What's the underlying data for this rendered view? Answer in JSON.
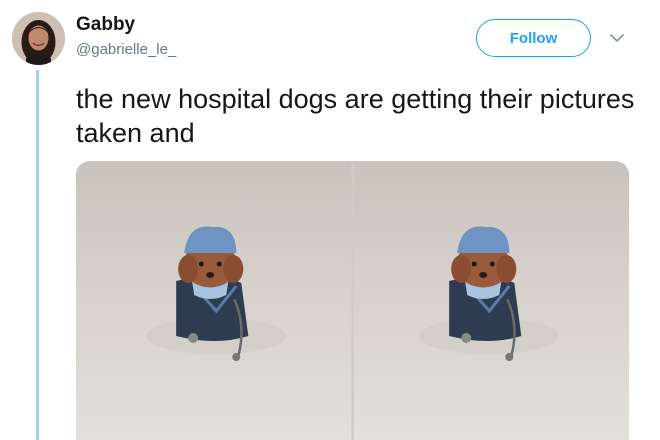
{
  "tweet": {
    "author": {
      "display_name": "Gabby",
      "handle": "@gabrielle_le_",
      "avatar_icon": "profile-photo"
    },
    "follow_label": "Follow",
    "menu_icon": "chevron-down-icon",
    "text": "the new hospital dogs are getting their pictures taken and",
    "media": [
      {
        "icon": "photo-dog-in-scrubs"
      },
      {
        "icon": "photo-dog-in-scrubs"
      }
    ]
  },
  "colors": {
    "accent": "#1da1f2",
    "thread_line": "#9fd0f2",
    "text": "#14171a",
    "secondary_text": "#657786"
  }
}
